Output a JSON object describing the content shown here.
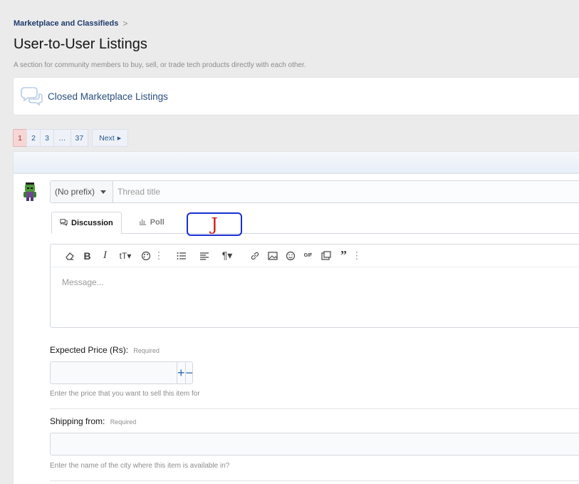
{
  "breadcrumb": {
    "items": [
      "Marketplace and Classifieds"
    ],
    "separator": ">"
  },
  "page": {
    "title": "User-to-User Listings",
    "description": "A section for community members to buy, sell, or trade tech products directly with each other."
  },
  "node": {
    "title": "Closed Marketplace Listings",
    "icon": "chat-bubbles-icon"
  },
  "pagination": {
    "pages": [
      "1",
      "2",
      "3",
      "…",
      "37"
    ],
    "current": "1",
    "next_label": "Next"
  },
  "thread_form": {
    "prefix_label": "(No prefix)",
    "title_placeholder": "Thread title",
    "tabs": [
      {
        "label": "Discussion",
        "icon": "comments-icon",
        "active": true
      },
      {
        "label": "Poll",
        "icon": "bar-chart-icon",
        "active": false
      }
    ],
    "annotation_text": "J",
    "message_placeholder": "Message...",
    "fields": {
      "price": {
        "label": "Expected Price (Rs):",
        "required": "Required",
        "hint": "Enter the price that you want to sell this item for",
        "plus": "+",
        "minus": "−"
      },
      "shipping": {
        "label": "Shipping from:",
        "required": "Required",
        "hint": "Enter the name of the city where this item is available in?"
      }
    }
  },
  "colors": {
    "accent": "#2577b1",
    "current_page_bg": "#f7d6d6",
    "annotation_border": "#1a2fd4",
    "annotation_text": "#d11a1a"
  }
}
